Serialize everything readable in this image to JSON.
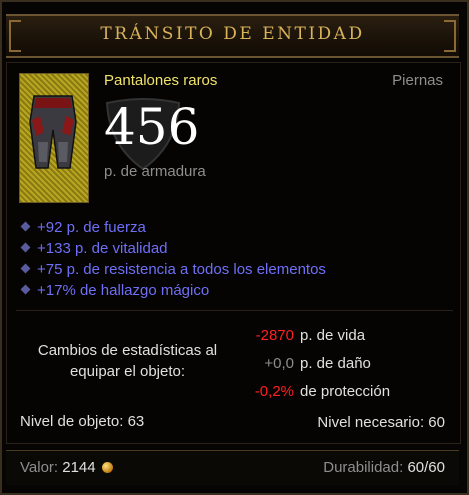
{
  "header": {
    "title": "TRÁNSITO DE ENTIDAD"
  },
  "item": {
    "name": "Pantalones raros",
    "slot": "Piernas",
    "armor_value": "456",
    "armor_label": "p. de armadura",
    "icon": "pants-icon"
  },
  "properties": [
    "+92 p. de fuerza",
    "+133 p. de vitalidad",
    "+75 p. de resistencia a todos los elementos",
    "+17% de hallazgo mágico"
  ],
  "stat_changes": {
    "title": "Cambios de estadísticas al equipar el objeto:",
    "rows": [
      {
        "value": "-2870",
        "label": "p. de vida"
      },
      {
        "value": "+0,0",
        "label": "p. de daño"
      },
      {
        "value": "-0,2%",
        "label": "de protección"
      }
    ]
  },
  "levels": {
    "item_level": "Nivel de objeto: 63",
    "required_level": "Nivel necesario: 60"
  },
  "footer": {
    "value_label": "Valor:",
    "value": "2144",
    "durability_label": "Durabilidad:",
    "durability": "60/60"
  },
  "colors": {
    "title": "#d8b35a",
    "item_name": "#f0e36a",
    "magic": "#6f6ff7",
    "negative": "#ff2020",
    "neutral": "#8e8e8e"
  }
}
